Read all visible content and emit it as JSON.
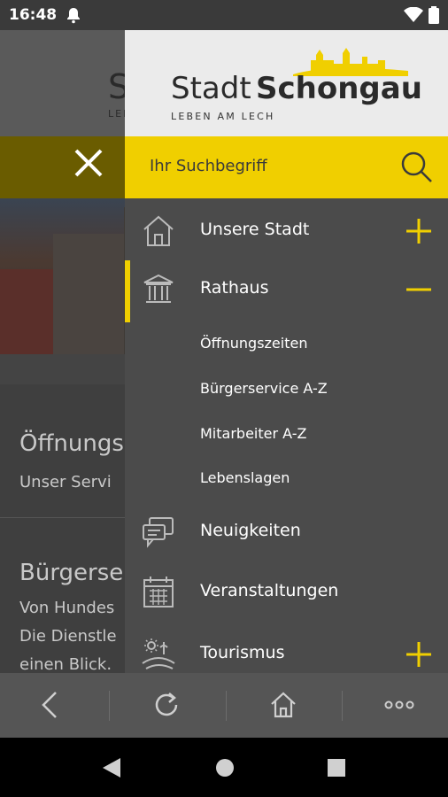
{
  "status_bar": {
    "time": "16:48"
  },
  "underlay": {
    "logo_fragment": "S",
    "logo_sub_fragment": "LEBE",
    "items": [
      {
        "title": "Öffnungs",
        "subtitle": "Unser Servi"
      },
      {
        "title": "Bürgerse",
        "line1": "Von Hundes",
        "line2": "Die Dienstle",
        "line3": "einen Blick."
      }
    ]
  },
  "drawer": {
    "logo": {
      "word1": "Stadt",
      "word2": "Schongau",
      "tagline": "LEBEN AM LECH"
    },
    "search": {
      "placeholder": "Ihr Suchbegriff"
    },
    "menu": [
      {
        "label": "Unsere Stadt",
        "icon": "house-icon",
        "toggle": "+"
      },
      {
        "label": "Rathaus",
        "icon": "townhall-icon",
        "toggle": "−",
        "active": true,
        "submenu": [
          "Öffnungszeiten",
          "Bürgerservice A-Z",
          "Mitarbeiter A-Z",
          "Lebenslagen"
        ]
      },
      {
        "label": "Neuigkeiten",
        "icon": "chat-bubbles-icon"
      },
      {
        "label": "Veranstaltungen",
        "icon": "calendar-icon"
      },
      {
        "label": "Tourismus",
        "icon": "landscape-icon",
        "toggle": "+"
      }
    ]
  },
  "toolbar": {
    "buttons": [
      "back-icon",
      "reload-icon",
      "home-icon",
      "more-icon"
    ]
  },
  "colors": {
    "accent": "#f0cf00",
    "drawer_bg": "#4b4b4b",
    "toolbar_bg": "#555555"
  }
}
